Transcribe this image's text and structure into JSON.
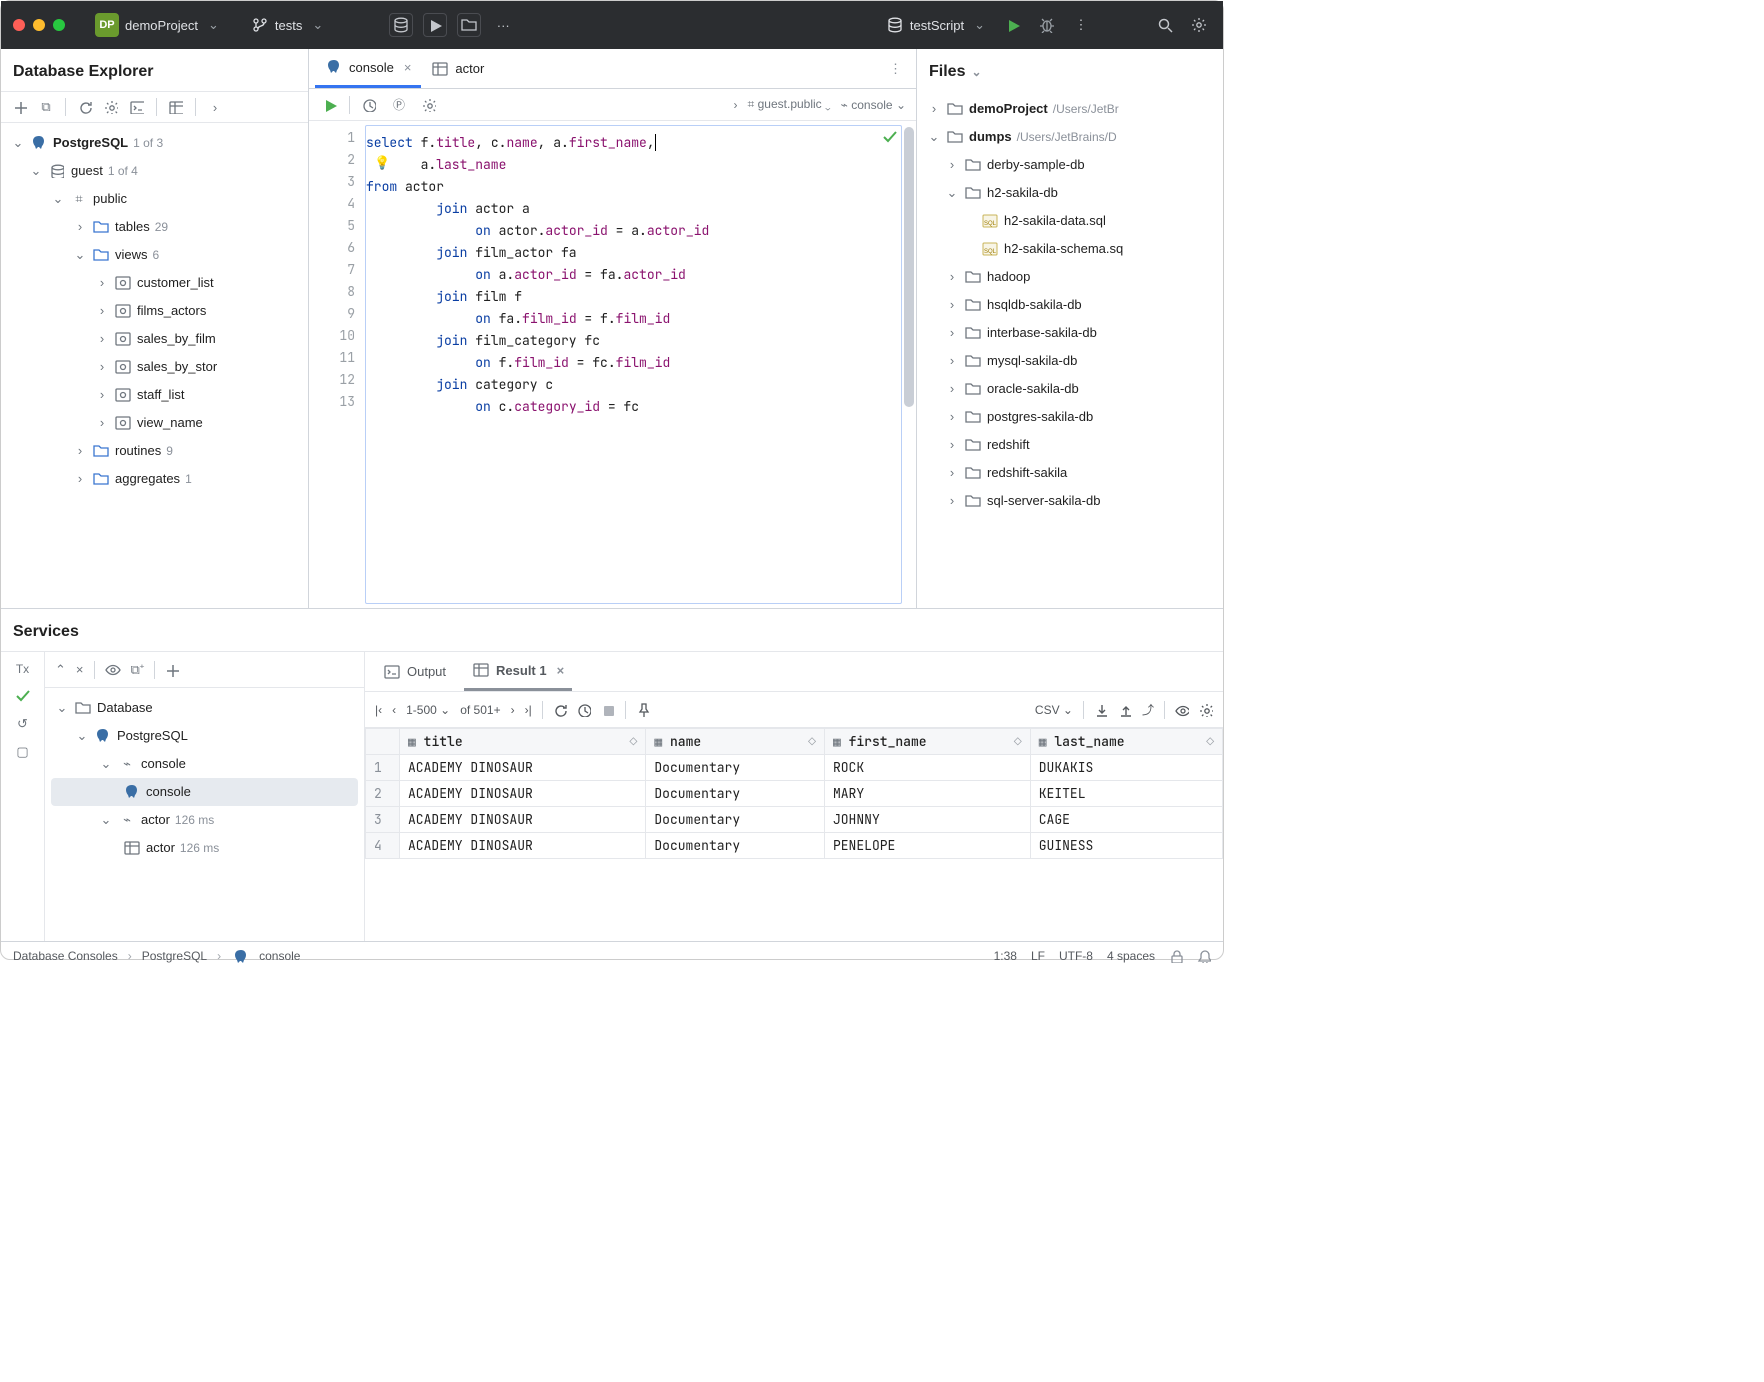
{
  "titlebar": {
    "project_badge": "DP",
    "project_name": "demoProject",
    "branch_label": "tests",
    "script_label": "testScript"
  },
  "dbExplorer": {
    "title": "Database Explorer",
    "root_label": "PostgreSQL",
    "root_count": "1 of 3",
    "schema_label": "guest",
    "schema_count": "1 of 4",
    "public_label": "public",
    "tables_label": "tables",
    "tables_count": "29",
    "views_label": "views",
    "views_count": "6",
    "views": [
      "customer_list",
      "films_actors",
      "sales_by_film",
      "sales_by_stor",
      "staff_list",
      "view_name"
    ],
    "routines_label": "routines",
    "routines_count": "9",
    "aggregates_label": "aggregates",
    "aggregates_count": "1"
  },
  "editor": {
    "tab1": "console",
    "tab2": "actor",
    "schema_selector": "guest.public",
    "session_selector": "console",
    "lines": [
      "1",
      "2",
      "3",
      "4",
      "5",
      "6",
      "7",
      "8",
      "9",
      "10",
      "11",
      "12",
      "13"
    ],
    "code": {
      "l1a": "select",
      "l1b": " f.",
      "l1c": "title",
      "l1d": ", c.",
      "l1e": "name",
      "l1f": ", a.",
      "l1g": "first_name",
      "l1h": ",",
      "l2a": "       a.",
      "l2b": "last_name",
      "l3a": "from",
      "l3b": " actor",
      "l4a": "         ",
      "l4b": "join",
      "l4c": " actor a",
      "l5a": "              ",
      "l5b": "on",
      "l5c": " actor.",
      "l5d": "actor_id",
      "l5e": " = a.",
      "l5f": "actor_id",
      "l6a": "         ",
      "l6b": "join",
      "l6c": " film_actor fa",
      "l7a": "              ",
      "l7b": "on",
      "l7c": " a.",
      "l7d": "actor_id",
      "l7e": " = fa.",
      "l7f": "actor_id",
      "l8a": "         ",
      "l8b": "join",
      "l8c": " film f",
      "l9a": "              ",
      "l9b": "on",
      "l9c": " fa.",
      "l9d": "film_id",
      "l9e": " = f.",
      "l9f": "film_id",
      "l10a": "         ",
      "l10b": "join",
      "l10c": " film_category fc",
      "l11a": "              ",
      "l11b": "on",
      "l11c": " f.",
      "l11d": "film_id",
      "l11e": " = fc.",
      "l11f": "film_id",
      "l12a": "         ",
      "l12b": "join",
      "l12c": " category c",
      "l13a": "              ",
      "l13b": "on",
      "l13c": " c.",
      "l13d": "category_id",
      "l13e": " = fc"
    }
  },
  "filesPanel": {
    "title": "Files",
    "project_name": "demoProject",
    "project_path": "/Users/JetBr",
    "dumps_label": "dumps",
    "dumps_path": "/Users/JetBrains/D",
    "items": [
      {
        "label": "derby-sample-db",
        "type": "folder",
        "open": false
      },
      {
        "label": "h2-sakila-db",
        "type": "folder",
        "open": true
      },
      {
        "label": "h2-sakila-data.sql",
        "type": "sql"
      },
      {
        "label": "h2-sakila-schema.sq",
        "type": "sql"
      },
      {
        "label": "hadoop",
        "type": "folder",
        "open": false
      },
      {
        "label": "hsqldb-sakila-db",
        "type": "folder",
        "open": false
      },
      {
        "label": "interbase-sakila-db",
        "type": "folder",
        "open": false
      },
      {
        "label": "mysql-sakila-db",
        "type": "folder",
        "open": false
      },
      {
        "label": "oracle-sakila-db",
        "type": "folder",
        "open": false
      },
      {
        "label": "postgres-sakila-db",
        "type": "folder",
        "open": false
      },
      {
        "label": "redshift",
        "type": "folder",
        "open": false
      },
      {
        "label": "redshift-sakila",
        "type": "folder",
        "open": false
      },
      {
        "label": "sql-server-sakila-db",
        "type": "folder",
        "open": false
      }
    ]
  },
  "services": {
    "title": "Services",
    "tree": {
      "database": "Database",
      "postgres": "PostgreSQL",
      "console1": "console",
      "console2": "console",
      "actor": "actor",
      "actor_ms": "126 ms",
      "actor2": "actor",
      "actor2_ms": "126 ms"
    },
    "tabs": {
      "output": "Output",
      "result": "Result 1"
    },
    "pager": {
      "range": "1-500",
      "total": "of 501+"
    },
    "export_label": "CSV",
    "columns": [
      "title",
      "name",
      "first_name",
      "last_name"
    ],
    "rows": [
      [
        "ACADEMY DINOSAUR",
        "Documentary",
        "ROCK",
        "DUKAKIS"
      ],
      [
        "ACADEMY DINOSAUR",
        "Documentary",
        "MARY",
        "KEITEL"
      ],
      [
        "ACADEMY DINOSAUR",
        "Documentary",
        "JOHNNY",
        "CAGE"
      ],
      [
        "ACADEMY DINOSAUR",
        "Documentary",
        "PENELOPE",
        "GUINESS"
      ]
    ]
  },
  "statusbar": {
    "crumb1": "Database Consoles",
    "crumb2": "PostgreSQL",
    "crumb3": "console",
    "pos": "1:38",
    "eol": "LF",
    "encoding": "UTF-8",
    "indent": "4 spaces"
  }
}
